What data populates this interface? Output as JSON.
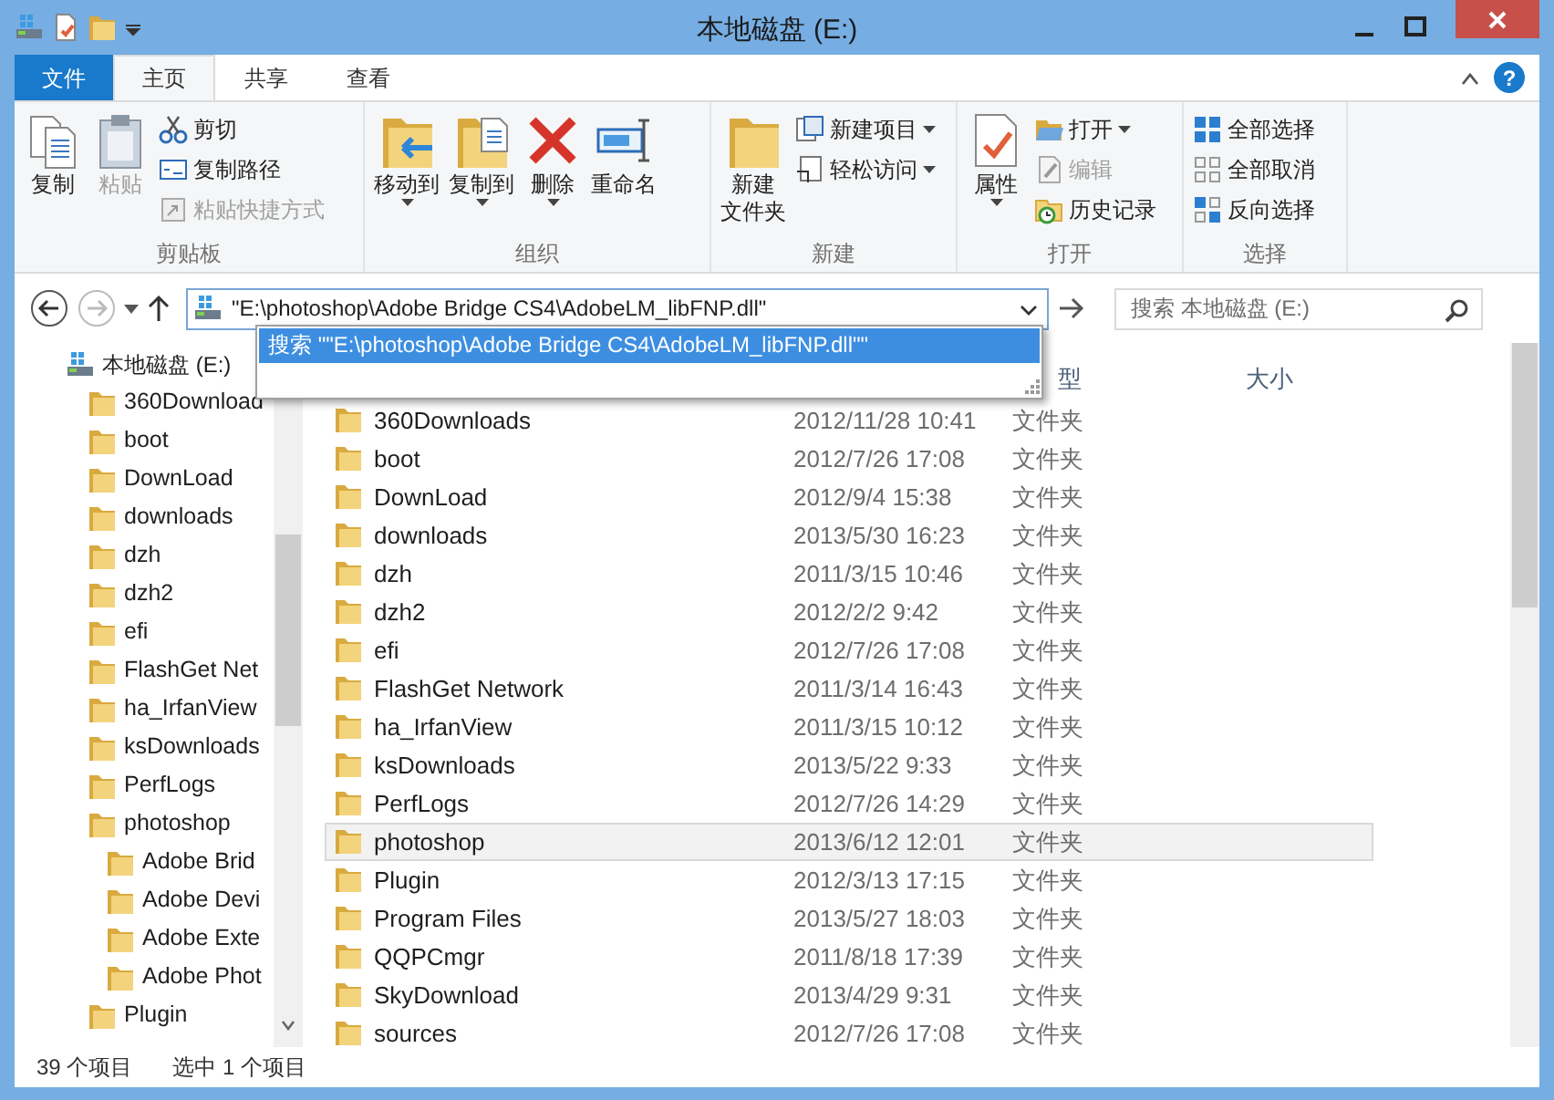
{
  "window": {
    "title": "本地磁盘 (E:)"
  },
  "ribbon_tabs": [
    {
      "label": "文件",
      "kind": "file",
      "selected": false
    },
    {
      "label": "主页",
      "kind": "tab",
      "selected": true
    },
    {
      "label": "共享",
      "kind": "tab",
      "selected": false
    },
    {
      "label": "查看",
      "kind": "tab",
      "selected": false
    }
  ],
  "help_label": "?",
  "ribbon_groups": [
    {
      "label": "剪贴板",
      "items": [
        {
          "label": "复制",
          "kind": "large",
          "disabled": false,
          "dropdown": false
        },
        {
          "label": "粘贴",
          "kind": "large",
          "disabled": true,
          "dropdown": false
        },
        {
          "label": "剪切",
          "kind": "small",
          "disabled": false,
          "dropdown": false
        },
        {
          "label": "复制路径",
          "kind": "small",
          "disabled": false,
          "dropdown": false
        },
        {
          "label": "粘贴快捷方式",
          "kind": "small",
          "disabled": true,
          "dropdown": false
        }
      ]
    },
    {
      "label": "组织",
      "items": [
        {
          "label": "移动到",
          "kind": "large",
          "disabled": false,
          "dropdown": true
        },
        {
          "label": "复制到",
          "kind": "large",
          "disabled": false,
          "dropdown": true
        },
        {
          "label": "删除",
          "kind": "large",
          "disabled": false,
          "dropdown": true
        },
        {
          "label": "重命名",
          "kind": "large",
          "disabled": false,
          "dropdown": false
        }
      ]
    },
    {
      "label": "新建",
      "items": [
        {
          "label_lines": [
            "新建",
            "文件夹"
          ],
          "kind": "large",
          "disabled": false,
          "dropdown": false
        },
        {
          "label": "新建项目",
          "kind": "small",
          "disabled": false,
          "dropdown": true
        },
        {
          "label": "轻松访问",
          "kind": "small",
          "disabled": false,
          "dropdown": true
        }
      ]
    },
    {
      "label": "打开",
      "items": [
        {
          "label": "属性",
          "kind": "large",
          "disabled": false,
          "dropdown": true
        },
        {
          "label": "打开",
          "kind": "small",
          "disabled": false,
          "dropdown": true
        },
        {
          "label": "编辑",
          "kind": "small",
          "disabled": true,
          "dropdown": false
        },
        {
          "label": "历史记录",
          "kind": "small",
          "disabled": false,
          "dropdown": false
        }
      ]
    },
    {
      "label": "选择",
      "items": [
        {
          "label": "全部选择",
          "kind": "small",
          "disabled": false,
          "dropdown": false
        },
        {
          "label": "全部取消",
          "kind": "small",
          "disabled": false,
          "dropdown": false
        },
        {
          "label": "反向选择",
          "kind": "small",
          "disabled": false,
          "dropdown": false
        }
      ]
    }
  ],
  "address": {
    "value": "\"E:\\photoshop\\Adobe Bridge CS4\\AdobeLM_libFNP.dll\"",
    "suggestion": "搜索 \"\"E:\\photoshop\\Adobe Bridge CS4\\AdobeLM_libFNP.dll\"\""
  },
  "search": {
    "placeholder": "搜索 本地磁盘 (E:)"
  },
  "nav_tree": [
    {
      "label": "本地磁盘 (E:)",
      "kind": "drive",
      "children": [
        {
          "label": "360Download",
          "kind": "folder"
        },
        {
          "label": "boot",
          "kind": "folder"
        },
        {
          "label": "DownLoad",
          "kind": "folder"
        },
        {
          "label": "downloads",
          "kind": "folder"
        },
        {
          "label": "dzh",
          "kind": "folder"
        },
        {
          "label": "dzh2",
          "kind": "folder"
        },
        {
          "label": "efi",
          "kind": "folder"
        },
        {
          "label": "FlashGet Net",
          "kind": "folder"
        },
        {
          "label": "ha_IrfanView",
          "kind": "folder"
        },
        {
          "label": "ksDownloads",
          "kind": "folder"
        },
        {
          "label": "PerfLogs",
          "kind": "folder"
        },
        {
          "label": "photoshop",
          "kind": "folder",
          "children": [
            {
              "label": "Adobe Brid",
              "kind": "folder"
            },
            {
              "label": "Adobe Devi",
              "kind": "folder"
            },
            {
              "label": "Adobe Exte",
              "kind": "folder"
            },
            {
              "label": "Adobe Phot",
              "kind": "folder"
            }
          ]
        },
        {
          "label": "Plugin",
          "kind": "folder"
        }
      ]
    }
  ],
  "columns": [
    "型",
    "大小"
  ],
  "files": [
    {
      "name": "360Downloads",
      "date": "2012/11/28 10:41",
      "type": "文件夹",
      "selected": false
    },
    {
      "name": "boot",
      "date": "2012/7/26 17:08",
      "type": "文件夹",
      "selected": false
    },
    {
      "name": "DownLoad",
      "date": "2012/9/4 15:38",
      "type": "文件夹",
      "selected": false
    },
    {
      "name": "downloads",
      "date": "2013/5/30 16:23",
      "type": "文件夹",
      "selected": false
    },
    {
      "name": "dzh",
      "date": "2011/3/15 10:46",
      "type": "文件夹",
      "selected": false
    },
    {
      "name": "dzh2",
      "date": "2012/2/2 9:42",
      "type": "文件夹",
      "selected": false
    },
    {
      "name": "efi",
      "date": "2012/7/26 17:08",
      "type": "文件夹",
      "selected": false
    },
    {
      "name": "FlashGet Network",
      "date": "2011/3/14 16:43",
      "type": "文件夹",
      "selected": false
    },
    {
      "name": "ha_IrfanView",
      "date": "2011/3/15 10:12",
      "type": "文件夹",
      "selected": false
    },
    {
      "name": "ksDownloads",
      "date": "2013/5/22 9:33",
      "type": "文件夹",
      "selected": false
    },
    {
      "name": "PerfLogs",
      "date": "2012/7/26 14:29",
      "type": "文件夹",
      "selected": false
    },
    {
      "name": "photoshop",
      "date": "2013/6/12 12:01",
      "type": "文件夹",
      "selected": true
    },
    {
      "name": "Plugin",
      "date": "2012/3/13 17:15",
      "type": "文件夹",
      "selected": false
    },
    {
      "name": "Program Files",
      "date": "2013/5/27 18:03",
      "type": "文件夹",
      "selected": false
    },
    {
      "name": "QQPCmgr",
      "date": "2011/8/18 17:39",
      "type": "文件夹",
      "selected": false
    },
    {
      "name": "SkyDownload",
      "date": "2013/4/29 9:31",
      "type": "文件夹",
      "selected": false
    },
    {
      "name": "sources",
      "date": "2012/7/26 17:08",
      "type": "文件夹",
      "selected": false
    }
  ],
  "status_bar": {
    "item_count": "39 个项目",
    "selection": "选中 1 个项目"
  }
}
